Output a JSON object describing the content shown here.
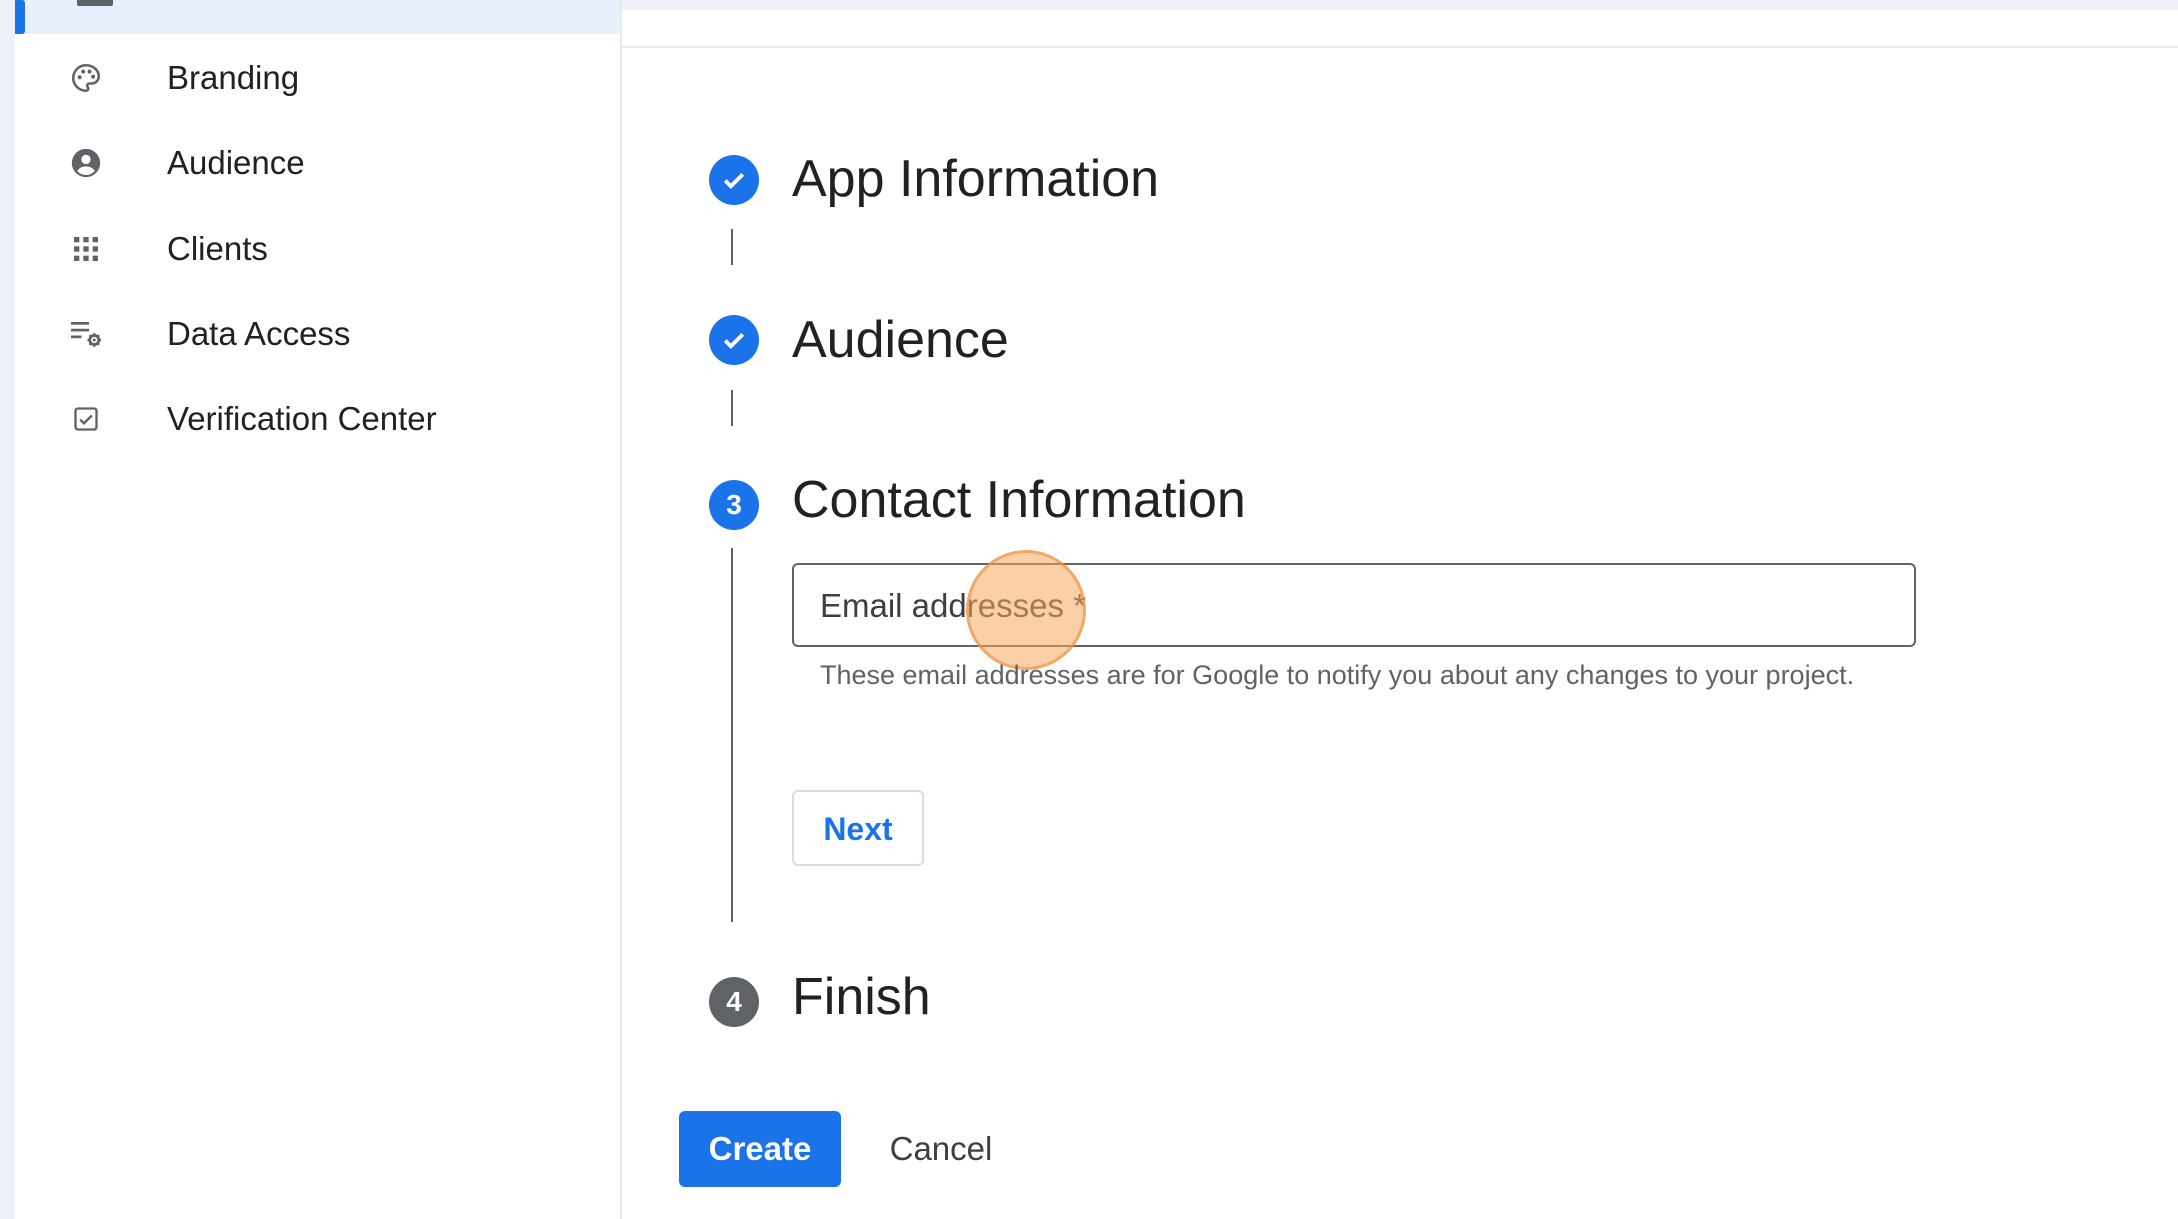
{
  "sidebar": {
    "items": [
      {
        "label": "Branding",
        "icon": "palette-icon"
      },
      {
        "label": "Audience",
        "icon": "account-circle-icon"
      },
      {
        "label": "Clients",
        "icon": "apps-grid-icon"
      },
      {
        "label": "Data Access",
        "icon": "list-settings-icon"
      },
      {
        "label": "Verification Center",
        "icon": "check-box-icon"
      }
    ]
  },
  "stepper": {
    "steps": [
      {
        "label": "App Information",
        "state": "completed"
      },
      {
        "label": "Audience",
        "state": "completed"
      },
      {
        "label": "Contact Information",
        "number": "3",
        "state": "active"
      },
      {
        "label": "Finish",
        "number": "4",
        "state": "upcoming"
      }
    ]
  },
  "contact": {
    "email_label": "Email addresses *",
    "email_hint": "These email addresses are for Google to notify you about any changes to your project.",
    "next_label": "Next"
  },
  "actions": {
    "create_label": "Create",
    "cancel_label": "Cancel"
  },
  "colors": {
    "accent": "#1a73e8",
    "step_upcoming": "#5f6368",
    "click_highlight": "#f7aa5c"
  }
}
